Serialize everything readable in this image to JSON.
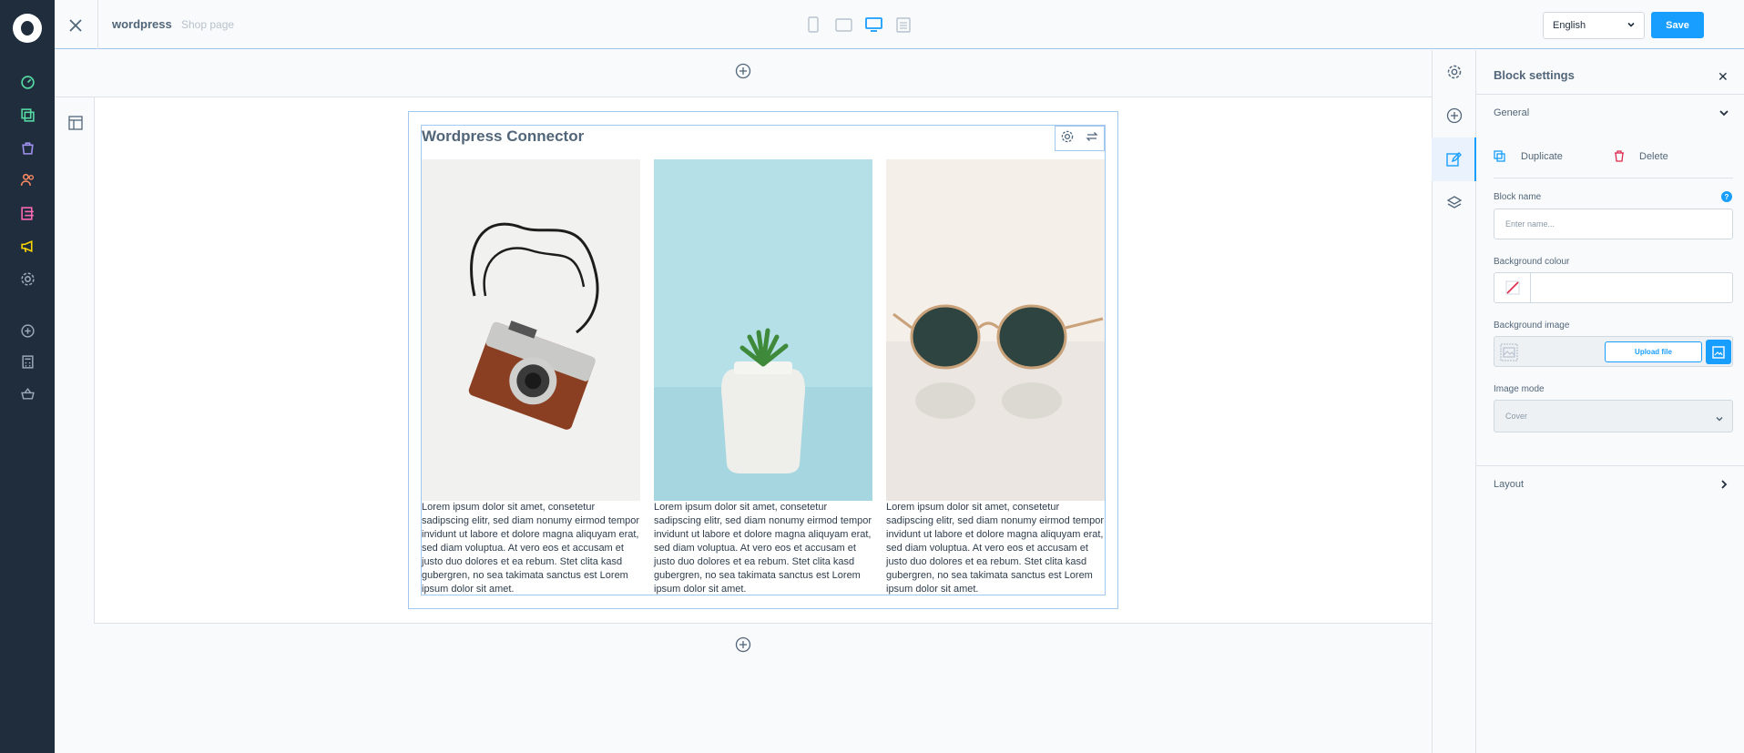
{
  "header": {
    "title": "wordpress",
    "subtitle": "Shop page",
    "language": "English",
    "save_label": "Save"
  },
  "block": {
    "title": "Wordpress Connector",
    "columns": [
      {
        "image": "camera-photo",
        "text": "Lorem ipsum dolor sit amet, consetetur sadipscing elitr, sed diam nonumy eirmod tempor invidunt ut labore et dolore magna aliquyam erat, sed diam voluptua. At vero eos et accusam et justo duo dolores et ea rebum. Stet clita kasd gubergren, no sea takimata sanctus est Lorem ipsum dolor sit amet."
      },
      {
        "image": "plant-photo",
        "text": "Lorem ipsum dolor sit amet, consetetur sadipscing elitr, sed diam nonumy eirmod tempor invidunt ut labore et dolore magna aliquyam erat, sed diam voluptua. At vero eos et accusam et justo duo dolores et ea rebum. Stet clita kasd gubergren, no sea takimata sanctus est Lorem ipsum dolor sit amet."
      },
      {
        "image": "sunglasses-photo",
        "text": "Lorem ipsum dolor sit amet, consetetur sadipscing elitr, sed diam nonumy eirmod tempor invidunt ut labore et dolore magna aliquyam erat, sed diam voluptua. At vero eos et accusam et justo duo dolores et ea rebum. Stet clita kasd gubergren, no sea takimata sanctus est Lorem ipsum dolor sit amet."
      }
    ]
  },
  "panel": {
    "title": "Block settings",
    "general_label": "General",
    "duplicate_label": "Duplicate",
    "delete_label": "Delete",
    "block_name_label": "Block name",
    "block_name_placeholder": "Enter name...",
    "background_colour_label": "Background colour",
    "background_image_label": "Background image",
    "upload_label": "Upload file",
    "image_mode_label": "Image mode",
    "image_mode_value": "Cover",
    "layout_label": "Layout"
  },
  "colors": {
    "sidebar": "#1f2d3d",
    "accent": "#189eff",
    "delete": "#de294c"
  }
}
